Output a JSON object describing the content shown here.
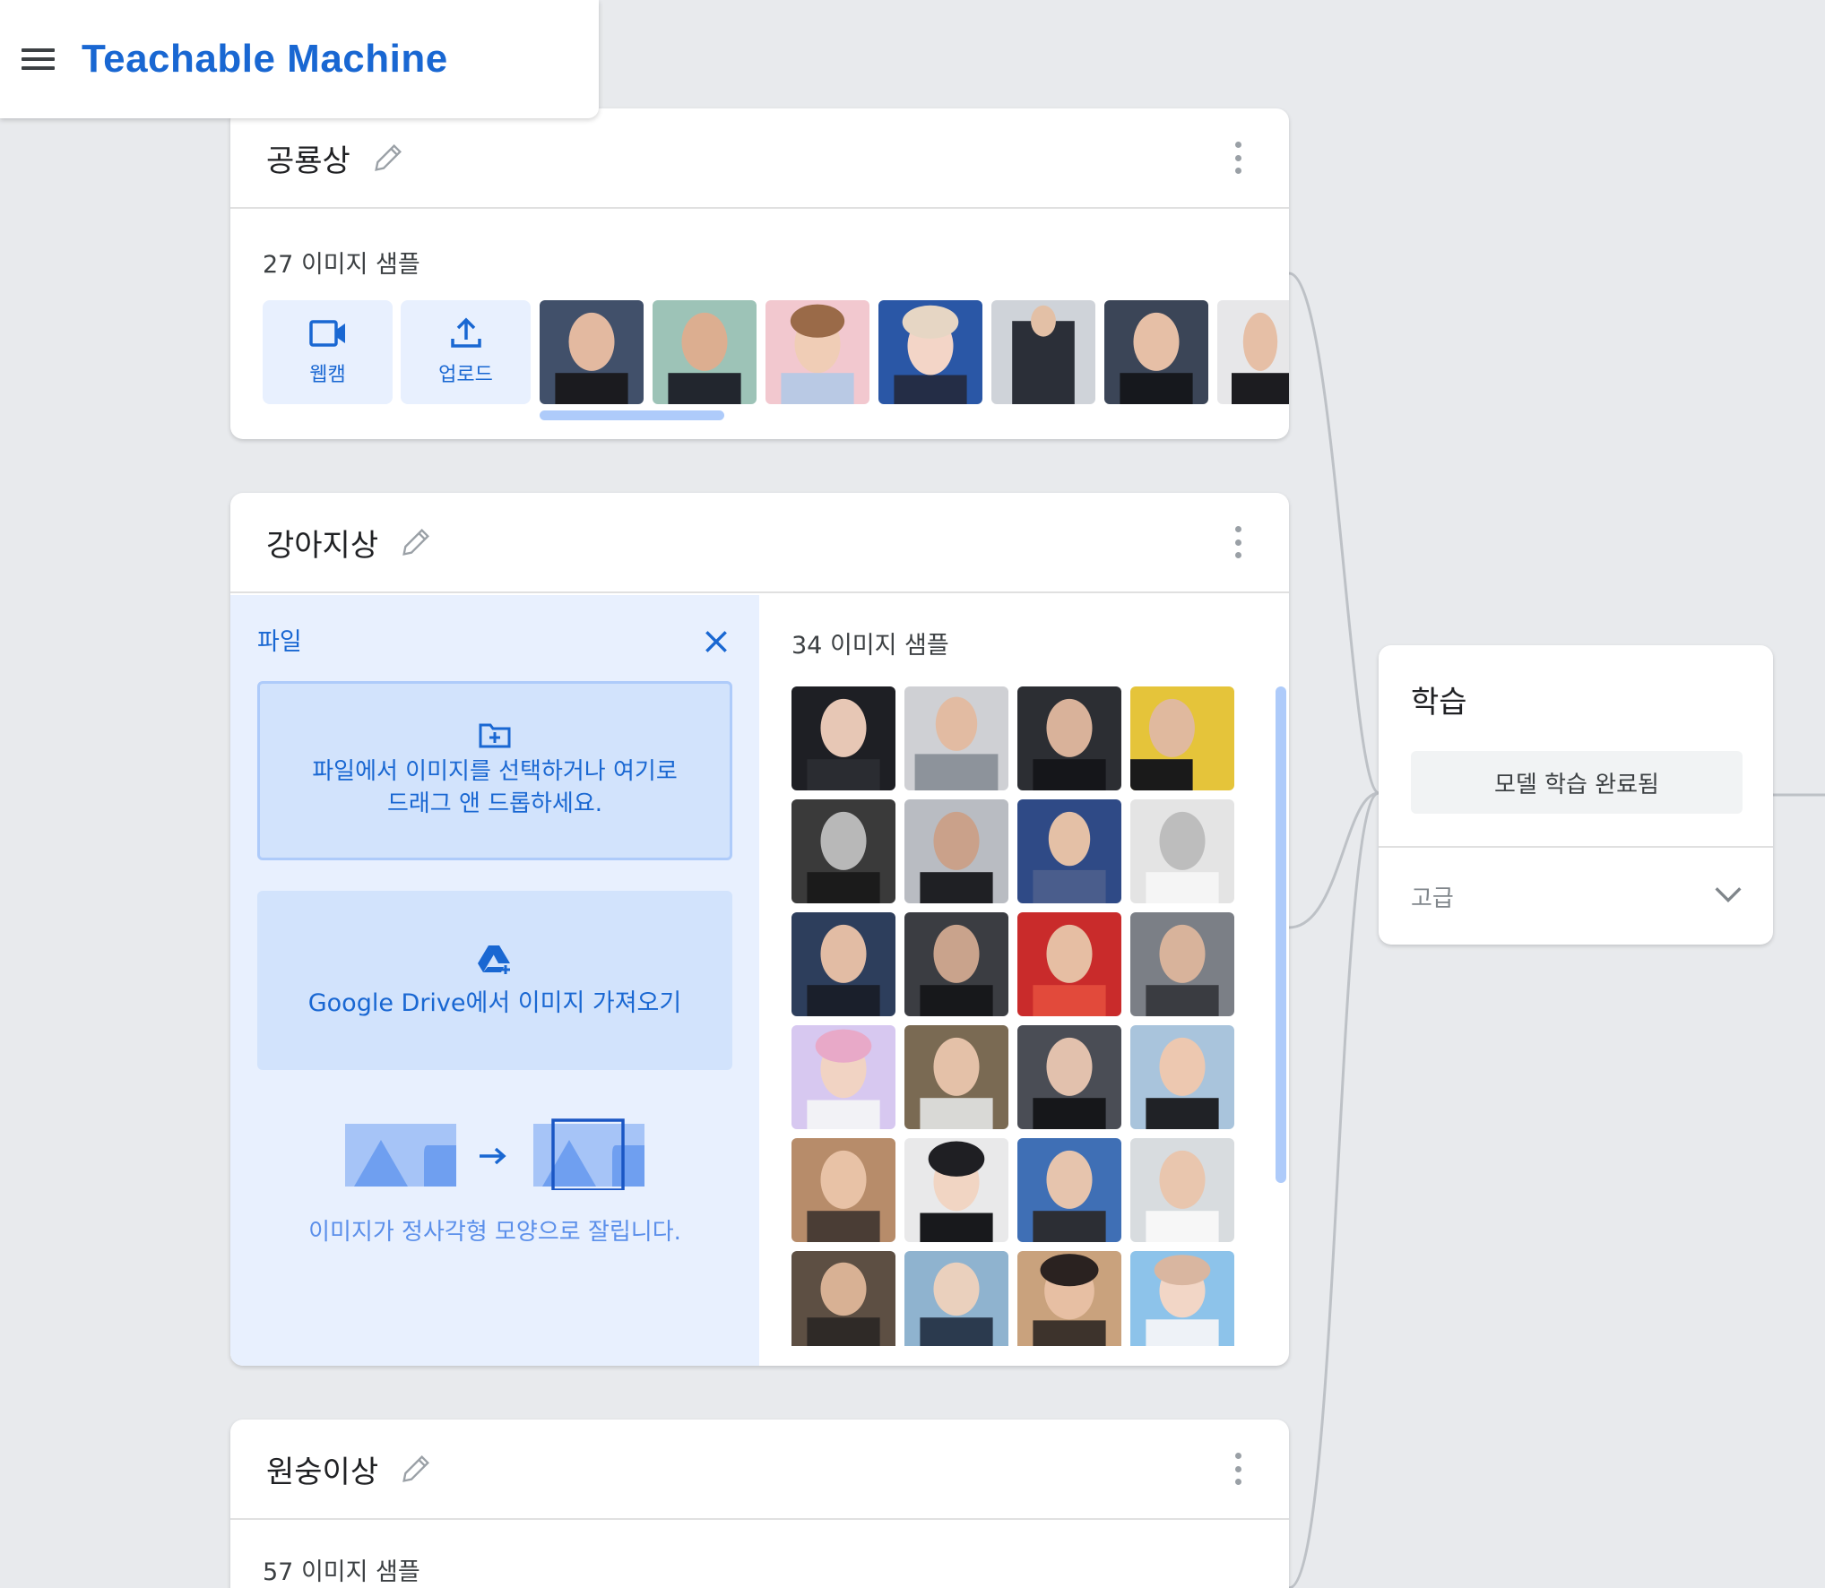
{
  "app": {
    "title": "Teachable Machine"
  },
  "classes": [
    {
      "name": "공룡상",
      "samples_label": "27 이미지 샘플",
      "webcam_label": "웹캠",
      "upload_label": "업로드"
    },
    {
      "name": "강아지상",
      "samples_label": "34 이미지 샘플"
    },
    {
      "name": "원숭이상",
      "samples_label": "57 이미지 샘플"
    }
  ],
  "upload_pane": {
    "title": "파일",
    "drop_text_line1": "파일에서 이미지를 선택하거나 여기로",
    "drop_text_line2": "드래그 앤 드롭하세요.",
    "drive_text": "Google Drive에서 이미지 가져오기",
    "crop_note": "이미지가 정사각형 모양으로 잘립니다."
  },
  "training": {
    "title": "학습",
    "status_button": "모델 학습 완료됨",
    "advanced_label": "고급"
  },
  "colors": {
    "accent": "#1967d2",
    "light_accent": "#e8f0fe",
    "background": "#e8eaed"
  }
}
